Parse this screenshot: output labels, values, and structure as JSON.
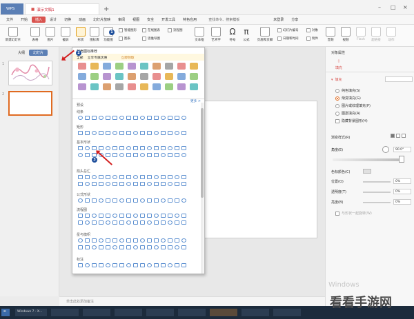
{
  "titlebar": {
    "app_tab": "WPS",
    "doc_tab": "演示文稿1",
    "new_tab_glyph": "+",
    "win_min": "–",
    "win_max": "□",
    "win_close": "×"
  },
  "menubar": {
    "file": "文件",
    "items": [
      "开始",
      "插入",
      "设计",
      "切换",
      "动画",
      "幻灯片放映",
      "审阅",
      "视图",
      "安全",
      "开发工具",
      "特色应用"
    ],
    "active_index": 1,
    "search_hint": "查找命令、搜索模板",
    "login": "未登录",
    "share": "分享"
  },
  "ribbon": {
    "new_slide": "新建幻灯片",
    "table": "表格",
    "picture": "图片",
    "screenshot": "截屏",
    "shapes": "形状",
    "icon_lib": "图标库",
    "function_chart": "功能图",
    "smart_graphic": "智能图形",
    "online_chart": "在线图表",
    "flowchart": "流程图",
    "chart": "图表",
    "mind_map": "思维导图",
    "textbox": "文本框",
    "wordart": "艺术字",
    "symbol": "符号",
    "formula": "公式",
    "header_footer": "页眉和页脚",
    "slide_number": "幻灯片编号",
    "datetime": "日期和时间",
    "object": "对象",
    "attachment": "附件",
    "audio": "音频",
    "video": "视频",
    "flash": "Flash",
    "hyperlink": "超链接",
    "action": "动作"
  },
  "left_panel": {
    "tab_outline": "大纲",
    "tab_slides": "幻灯片",
    "slide_numbers": [
      "1",
      "2"
    ]
  },
  "notes": {
    "placeholder": "单击此处添加备注"
  },
  "right_panel": {
    "title": "对象属性",
    "fill_tab": "填充",
    "fill_section": "填充",
    "options": [
      "纯色填充(S)",
      "渐变填充(G)",
      "图片或纹理填充(P)",
      "图案填充(A)",
      "隐藏背景图形(H)"
    ],
    "selected_option": 1,
    "gradient_style": "渐变样式(R)",
    "angle_label": "角度(E)",
    "angle_value": "90.0°",
    "stop_color": "色标颜色(C)",
    "position_label": "位置(O)",
    "position_value": "0%",
    "transparency_label": "透明度(T)",
    "transparency_value": "0%",
    "brightness_label": "亮度(B)",
    "brightness_value": "0%",
    "scale_with_shape": "与形状一起旋转(W)"
  },
  "dropdown": {
    "header": "稻壳图标推荐",
    "sub_selected": "全部",
    "sub_alt": "立享专属优惠",
    "sub_more": "立即领取",
    "more": "更多 >",
    "preset": "预设",
    "sections": [
      "线条",
      "矩形",
      "基本形状",
      "箭头总汇",
      "公式形状",
      "流程图",
      "星与旗帜",
      "标注"
    ]
  },
  "annotations": {
    "badges": [
      "1",
      "2",
      "3"
    ],
    "arrow_color": "#d32020",
    "badge_color": "#1e4f9c"
  },
  "taskbar": {
    "items": [
      "Windows 7 - X...",
      "",
      "",
      "",
      "",
      "",
      "",
      "",
      "",
      ""
    ]
  },
  "watermark": {
    "os_text": "Windows",
    "site_logo": "看看手游网"
  },
  "colors": {
    "accent": "#d9534f",
    "selected_tab": "#5b7fb5",
    "shape_outline": "#5b8fd0"
  }
}
